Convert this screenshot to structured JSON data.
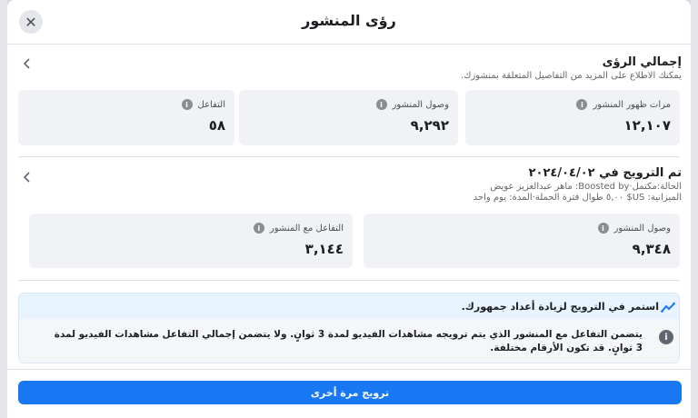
{
  "header": {
    "title": "رؤى المنشور",
    "close_icon": "close-icon"
  },
  "overview": {
    "title": "إجمالي الرؤى",
    "subtitle": "يمكنك الاطلاع على المزيد من التفاصيل المتعلقة بمنشورك.",
    "cards": [
      {
        "label": "مرات ظهور المنشور",
        "value": "١٢,١٠٧"
      },
      {
        "label": "وصول المنشور",
        "value": "٩,٢٩٢"
      },
      {
        "label": "التفاعل",
        "value": "٥٨"
      }
    ]
  },
  "promotion": {
    "title": "تم الترويج في ٢٠٢٤/٠٤/٠٢",
    "meta_line1": "الحالة:مكتمل·Boosted by: ماهر عبدالعزيز عويض",
    "meta_line2": "الميزانية: US$ ٥,٠٠ طوال فترة الحملة·المدة: يوم واحد",
    "cards": [
      {
        "label": "وصول المنشور",
        "value": "٩,٣٤٨"
      },
      {
        "label": "التفاعل مع المنشور",
        "value": "٣,١٤٤"
      }
    ]
  },
  "notice": {
    "headline": "استمر في الترويج لزيادة أعداد جمهورك.",
    "note": "يتضمن التفاعل مع المنشور الذي يتم ترويجه مشاهدات الفيديو لمدة 3 ثوانٍ. ولا يتضمن إجمالي التفاعل مشاهدات الفيديو لمدة 3 ثوانٍ. قد تكون الأرقام مختلفة."
  },
  "footer": {
    "boost_again_label": "ترويج مرة أخرى"
  },
  "colors": {
    "accent": "#1877f2",
    "card_bg": "#f0f2f5",
    "notice_bg": "#e7f3ff"
  }
}
